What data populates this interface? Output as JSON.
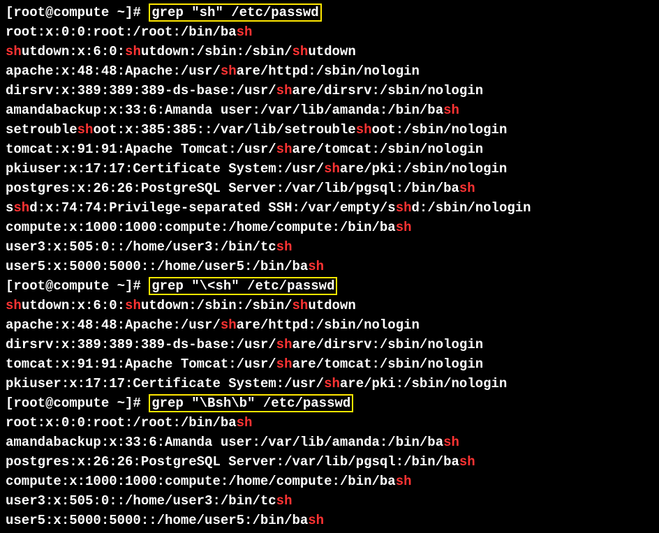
{
  "prompt1": "[root@compute ~]# ",
  "cmd1": "grep \"sh\" /etc/passwd",
  "prompt2": "[root@compute ~]# ",
  "cmd2": "grep \"\\<sh\" /etc/passwd",
  "prompt3": "[root@compute ~]# ",
  "cmd3": "grep \"\\Bsh\\b\" /etc/passwd",
  "out1": [
    [
      [
        "root:x:0:0:root:/root:/bin/ba",
        0
      ],
      [
        "sh",
        1
      ]
    ],
    [
      [
        "sh",
        1
      ],
      [
        "utdown:x:6:0:",
        0
      ],
      [
        "sh",
        1
      ],
      [
        "utdown:/sbin:/sbin/",
        0
      ],
      [
        "sh",
        1
      ],
      [
        "utdown",
        0
      ]
    ],
    [
      [
        "apache:x:48:48:Apache:/usr/",
        0
      ],
      [
        "sh",
        1
      ],
      [
        "are/httpd:/sbin/nologin",
        0
      ]
    ],
    [
      [
        "dirsrv:x:389:389:389-ds-base:/usr/",
        0
      ],
      [
        "sh",
        1
      ],
      [
        "are/dirsrv:/sbin/nologin",
        0
      ]
    ],
    [
      [
        "amandabackup:x:33:6:Amanda user:/var/lib/amanda:/bin/ba",
        0
      ],
      [
        "sh",
        1
      ]
    ],
    [
      [
        "setrouble",
        0
      ],
      [
        "sh",
        1
      ],
      [
        "oot:x:385:385::/var/lib/setrouble",
        0
      ],
      [
        "sh",
        1
      ],
      [
        "oot:/sbin/nologin",
        0
      ]
    ],
    [
      [
        "tomcat:x:91:91:Apache Tomcat:/usr/",
        0
      ],
      [
        "sh",
        1
      ],
      [
        "are/tomcat:/sbin/nologin",
        0
      ]
    ],
    [
      [
        "pkiuser:x:17:17:Certificate System:/usr/",
        0
      ],
      [
        "sh",
        1
      ],
      [
        "are/pki:/sbin/nologin",
        0
      ]
    ],
    [
      [
        "postgres:x:26:26:PostgreSQL Server:/var/lib/pgsql:/bin/ba",
        0
      ],
      [
        "sh",
        1
      ]
    ],
    [
      [
        "s",
        0
      ],
      [
        "sh",
        1
      ],
      [
        "d:x:74:74:Privilege-separated SSH:/var/empty/s",
        0
      ],
      [
        "sh",
        1
      ],
      [
        "d:/sbin/nologin",
        0
      ]
    ],
    [
      [
        "compute:x:1000:1000:compute:/home/compute:/bin/ba",
        0
      ],
      [
        "sh",
        1
      ]
    ],
    [
      [
        "user3:x:505:0::/home/user3:/bin/tc",
        0
      ],
      [
        "sh",
        1
      ]
    ],
    [
      [
        "user5:x:5000:5000::/home/user5:/bin/ba",
        0
      ],
      [
        "sh",
        1
      ]
    ]
  ],
  "out2": [
    [
      [
        "sh",
        1
      ],
      [
        "utdown:x:6:0:",
        0
      ],
      [
        "sh",
        1
      ],
      [
        "utdown:/sbin:/sbin/",
        0
      ],
      [
        "sh",
        1
      ],
      [
        "utdown",
        0
      ]
    ],
    [
      [
        "apache:x:48:48:Apache:/usr/",
        0
      ],
      [
        "sh",
        1
      ],
      [
        "are/httpd:/sbin/nologin",
        0
      ]
    ],
    [
      [
        "dirsrv:x:389:389:389-ds-base:/usr/",
        0
      ],
      [
        "sh",
        1
      ],
      [
        "are/dirsrv:/sbin/nologin",
        0
      ]
    ],
    [
      [
        "tomcat:x:91:91:Apache Tomcat:/usr/",
        0
      ],
      [
        "sh",
        1
      ],
      [
        "are/tomcat:/sbin/nologin",
        0
      ]
    ],
    [
      [
        "pkiuser:x:17:17:Certificate System:/usr/",
        0
      ],
      [
        "sh",
        1
      ],
      [
        "are/pki:/sbin/nologin",
        0
      ]
    ]
  ],
  "out3": [
    [
      [
        "root:x:0:0:root:/root:/bin/ba",
        0
      ],
      [
        "sh",
        1
      ]
    ],
    [
      [
        "amandabackup:x:33:6:Amanda user:/var/lib/amanda:/bin/ba",
        0
      ],
      [
        "sh",
        1
      ]
    ],
    [
      [
        "postgres:x:26:26:PostgreSQL Server:/var/lib/pgsql:/bin/ba",
        0
      ],
      [
        "sh",
        1
      ]
    ],
    [
      [
        "compute:x:1000:1000:compute:/home/compute:/bin/ba",
        0
      ],
      [
        "sh",
        1
      ]
    ],
    [
      [
        "user3:x:505:0::/home/user3:/bin/tc",
        0
      ],
      [
        "sh",
        1
      ]
    ],
    [
      [
        "user5:x:5000:5000::/home/user5:/bin/ba",
        0
      ],
      [
        "sh",
        1
      ]
    ]
  ]
}
